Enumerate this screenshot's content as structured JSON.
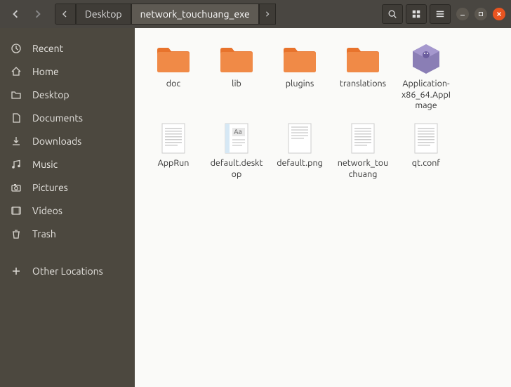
{
  "breadcrumbs": {
    "parent": "Desktop",
    "current": "network_touchuang_exe"
  },
  "sidebar": {
    "items": [
      {
        "label": "Recent",
        "icon": "clock"
      },
      {
        "label": "Home",
        "icon": "home"
      },
      {
        "label": "Desktop",
        "icon": "folder"
      },
      {
        "label": "Documents",
        "icon": "document"
      },
      {
        "label": "Downloads",
        "icon": "download"
      },
      {
        "label": "Music",
        "icon": "music"
      },
      {
        "label": "Pictures",
        "icon": "camera"
      },
      {
        "label": "Videos",
        "icon": "video"
      },
      {
        "label": "Trash",
        "icon": "trash"
      }
    ],
    "other": {
      "label": "Other Locations",
      "icon": "plus"
    }
  },
  "files": [
    {
      "name": "doc",
      "type": "folder"
    },
    {
      "name": "lib",
      "type": "folder"
    },
    {
      "name": "plugins",
      "type": "folder"
    },
    {
      "name": "translations",
      "type": "folder"
    },
    {
      "name": "Application-x86_64.AppImage",
      "type": "appimage"
    },
    {
      "name": "AppRun",
      "type": "text"
    },
    {
      "name": "default.desktop",
      "type": "desktop"
    },
    {
      "name": "default.png",
      "type": "image"
    },
    {
      "name": "network_touchuang",
      "type": "text"
    },
    {
      "name": "qt.conf",
      "type": "text"
    }
  ]
}
